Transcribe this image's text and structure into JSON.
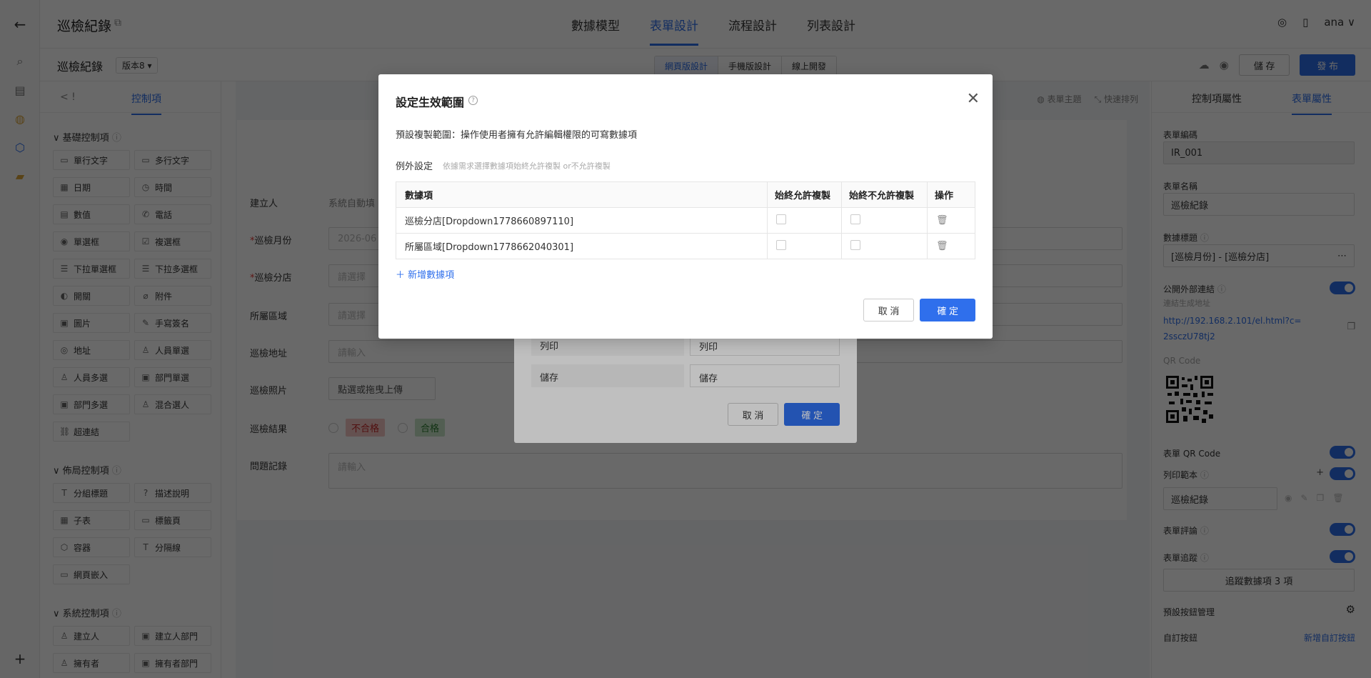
{
  "header": {
    "back": "←",
    "title": "巡檢紀錄",
    "nav": [
      "數據模型",
      "表單設計",
      "流程設計",
      "列表設計"
    ],
    "active_nav": 1,
    "user": "ana"
  },
  "subbar": {
    "form_title": "巡檢紀錄",
    "version": "版本8 ▾",
    "seg": [
      "網頁版設計",
      "手機版設計",
      "線上開發"
    ],
    "save": "儲 存",
    "publish": "發 布"
  },
  "palette": {
    "tab_nav": "< !",
    "tab_active": "控制項",
    "basic_title": "基礎控制項",
    "basic": [
      "單行文字",
      "多行文字",
      "日期",
      "時間",
      "數值",
      "電話",
      "單選框",
      "複選框",
      "下拉單選框",
      "下拉多選框",
      "開關",
      "附件",
      "圖片",
      "手寫簽名",
      "地址",
      "人員單選",
      "人員多選",
      "部門單選",
      "部門多選",
      "混合選人",
      "超連結"
    ],
    "basic_icons": [
      "▭",
      "▭",
      "▦",
      "◷",
      "▤",
      "✆",
      "◉",
      "☑",
      "☰",
      "☰",
      "◐",
      "⌀",
      "▣",
      "✎",
      "◎",
      "♙",
      "♙",
      "▣",
      "▣",
      "♙",
      "⛓"
    ],
    "layout_title": "佈局控制項",
    "layout": [
      "分組標題",
      "描述說明",
      "子表",
      "標籤頁",
      "容器",
      "分隔線",
      "網頁嵌入"
    ],
    "layout_icons": [
      "T",
      "?",
      "▦",
      "▭",
      "⬡",
      "T",
      "▭"
    ],
    "system_title": "系統控制項",
    "system": [
      "建立人",
      "建立人部門",
      "擁有者",
      "擁有者部門"
    ],
    "system_icons": [
      "♙",
      "▣",
      "♙",
      "▣"
    ]
  },
  "canvas": {
    "toolbar": [
      "表單主題",
      "快速排列"
    ],
    "fields": [
      {
        "label": "建立人",
        "required": false,
        "placeholder": "系統自動填"
      },
      {
        "label": "巡檢月份",
        "required": true,
        "placeholder": "2026-06"
      },
      {
        "label": "巡檢分店",
        "required": true,
        "placeholder": "請選擇"
      },
      {
        "label": "所屬區域",
        "required": false,
        "placeholder": "請選擇"
      },
      {
        "label": "巡檢地址",
        "required": false,
        "placeholder": "請輸入"
      },
      {
        "label": "巡檢照片",
        "required": false,
        "placeholder": "點選或拖曳上傳"
      },
      {
        "label": "巡檢結果",
        "required": false,
        "placeholder": ""
      },
      {
        "label": "問題記錄",
        "required": false,
        "placeholder": "請輸入"
      }
    ],
    "result_fail": "不合格",
    "result_pass": "合格"
  },
  "props": {
    "tabs": [
      "控制項屬性",
      "表單屬性"
    ],
    "form_code_label": "表單編碼",
    "form_code": "IR_001",
    "form_name_label": "表單名稱",
    "form_name": "巡檢紀錄",
    "data_title_label": "數據標題",
    "data_title": "[巡檢月份] - [巡檢分店]",
    "public_link_label": "公開外部連結",
    "public_link_hint": "連結生成地址",
    "public_link": "http://192.168.2.101/el.html?c=2ssczU78tj2",
    "qr_label": "QR Code",
    "form_qr_label": "表單 QR Code",
    "print_label": "列印範本",
    "print_value": "巡檢紀錄",
    "comment_label": "表單評論",
    "track_label": "表單追蹤",
    "track_value": "追蹤數據項 3 項",
    "default_btn_label": "預設按鈕管理",
    "custom_btn_label": "自訂按鈕",
    "custom_btn_link": "新增自訂按鈕"
  },
  "modal2": {
    "rows": [
      {
        "label": "列印",
        "value": "列印"
      },
      {
        "label": "儲存",
        "value": "儲存"
      }
    ],
    "cancel": "取 消",
    "ok": "確 定"
  },
  "modal": {
    "title": "設定生效範圍",
    "desc": "預設複製範圍：操作使用者擁有允許編輯權限的可寫數據項",
    "exception_label": "例外設定",
    "exception_hint": "依據需求選擇數據項始終允許複製 or不允許複製",
    "columns": [
      "數據項",
      "始終允許複製",
      "始終不允許複製",
      "操作"
    ],
    "rows": [
      {
        "item": "巡檢分店[Dropdown1778660897110]"
      },
      {
        "item": "所屬區域[Dropdown1778662040301]"
      }
    ],
    "add": "新增數據項",
    "cancel": "取 消",
    "ok": "確 定"
  }
}
